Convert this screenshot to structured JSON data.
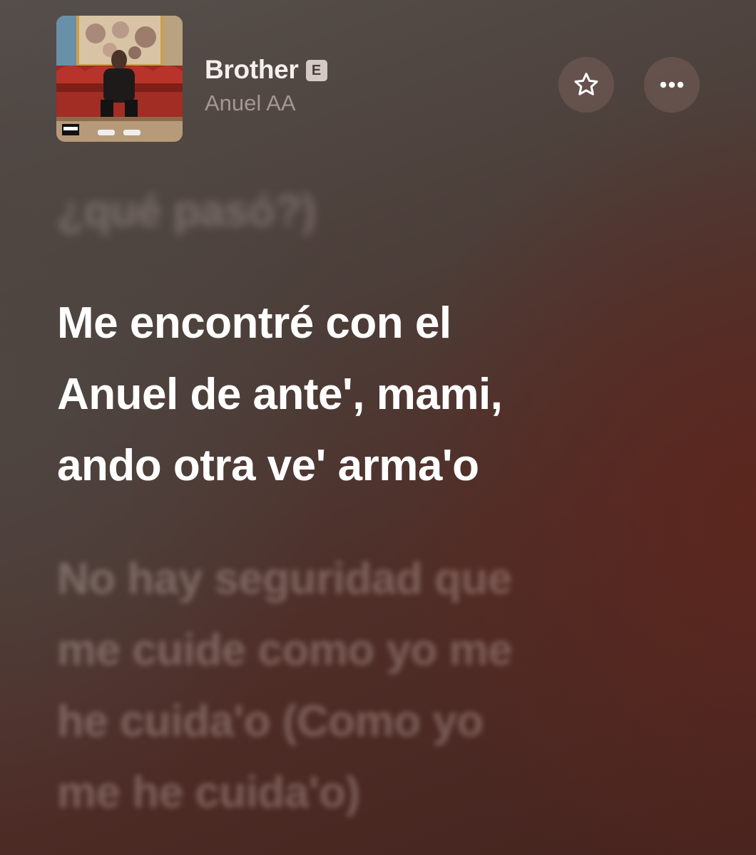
{
  "now_playing": {
    "title": "Brother",
    "explicit_badge": "E",
    "artist": "Anuel AA",
    "album_art_icon": "album-cover",
    "album_art_badge": "PARENTAL ADVISORY EXPLICIT CONTENT"
  },
  "actions": {
    "favorite_icon": "star-outline-icon",
    "more_icon": "ellipsis-icon"
  },
  "lyrics": {
    "previous_line": "¿qué pasó?)",
    "current_line": "Me encontré con el\nAnuel de ante', mami,\nando otra ve' arma'o",
    "next_line": "No hay seguridad que\nme cuide como yo me\nhe cuida'o (Como yo\nme he cuida'o)"
  },
  "colors": {
    "background_left": "#56504c",
    "background_right": "#4f2e28",
    "active_lyric": "#ffffff",
    "inactive_lyric": "#8a706b"
  }
}
